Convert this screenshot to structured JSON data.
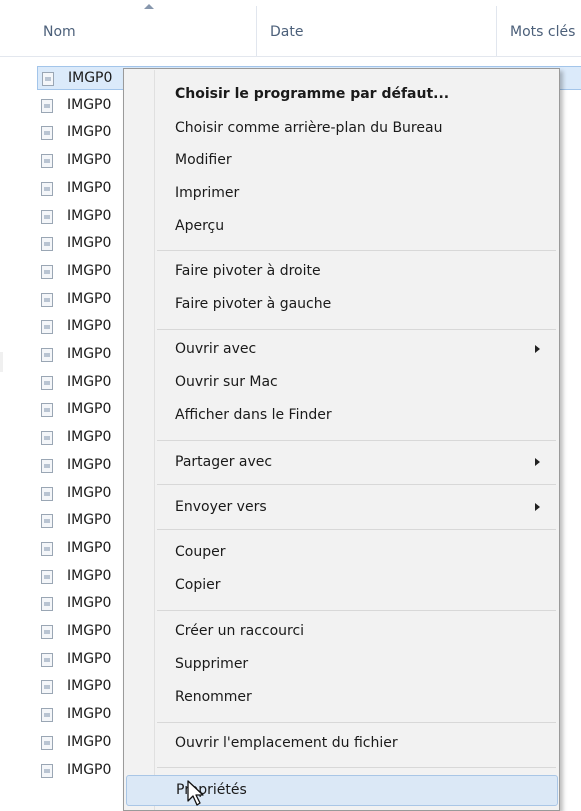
{
  "columns": {
    "name": "Nom",
    "date": "Date",
    "keywords": "Mots clés"
  },
  "files": [
    "IMGP0",
    "IMGP0",
    "IMGP0",
    "IMGP0",
    "IMGP0",
    "IMGP0",
    "IMGP0",
    "IMGP0",
    "IMGP0",
    "IMGP0",
    "IMGP0",
    "IMGP0",
    "IMGP0",
    "IMGP0",
    "IMGP0",
    "IMGP0",
    "IMGP0",
    "IMGP0",
    "IMGP0",
    "IMGP0",
    "IMGP0",
    "IMGP0",
    "IMGP0",
    "IMGP0",
    "IMGP0",
    "IMGP0"
  ],
  "menu": {
    "default_program": "Choisir le programme par défaut...",
    "set_wallpaper": "Choisir comme arrière-plan du Bureau",
    "edit": "Modifier",
    "print": "Imprimer",
    "preview": "Aperçu",
    "rotate_right": "Faire pivoter à droite",
    "rotate_left": "Faire pivoter à gauche",
    "open_with": "Ouvrir avec",
    "open_on_mac": "Ouvrir sur Mac",
    "show_in_finder": "Afficher dans le Finder",
    "share_with": "Partager avec",
    "send_to": "Envoyer vers",
    "cut": "Couper",
    "copy": "Copier",
    "create_shortcut": "Créer un raccourci",
    "delete": "Supprimer",
    "rename": "Renommer",
    "open_location": "Ouvrir l'emplacement du fichier",
    "properties": "Propriétés"
  },
  "icons": {
    "file": "image-file-icon",
    "submenu": "chevron-right-icon",
    "pointer": "mouse-pointer-icon"
  }
}
